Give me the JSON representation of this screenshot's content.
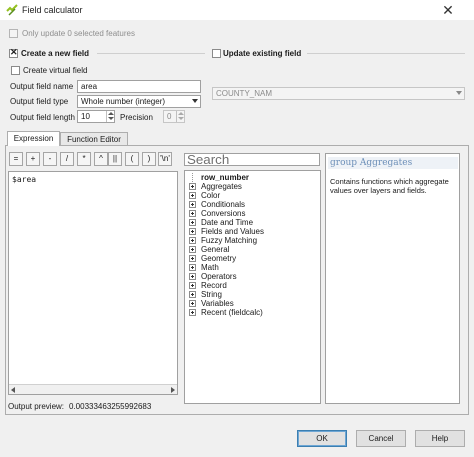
{
  "window": {
    "title": "Field calculator",
    "close_glyph": "✕"
  },
  "options": {
    "only_update_selected": "Only update 0 selected features",
    "create_new_field": "Create a new field",
    "update_existing_field": "Update existing field",
    "create_virtual_field": "Create virtual field"
  },
  "new_field": {
    "name_label": "Output field name",
    "name_value": "area",
    "type_label": "Output field type",
    "type_value": "Whole number (integer)",
    "length_label": "Output field length",
    "length_value": "10",
    "precision_label": "Precision",
    "precision_value": "0"
  },
  "existing_field": {
    "value": "COUNTY_NAM"
  },
  "tabs": [
    {
      "label": "Expression"
    },
    {
      "label": "Function Editor"
    }
  ],
  "operators": [
    "=",
    "+",
    "-",
    "/",
    "*",
    "^",
    "||",
    "(",
    ")",
    "'\\n'"
  ],
  "expression": {
    "text": "$area"
  },
  "search": {
    "placeholder": "Search"
  },
  "functions": [
    "row_number",
    "Aggregates",
    "Color",
    "Conditionals",
    "Conversions",
    "Date and Time",
    "Fields and Values",
    "Fuzzy Matching",
    "General",
    "Geometry",
    "Math",
    "Operators",
    "Record",
    "String",
    "Variables",
    "Recent (fieldcalc)"
  ],
  "help": {
    "title": "group Aggregates",
    "body": "Contains functions which aggregate values over layers and fields."
  },
  "preview": {
    "label": "Output preview:",
    "value": "0.00333463255992683"
  },
  "footer": {
    "ok": "OK",
    "cancel": "Cancel",
    "help": "Help"
  },
  "colors": {
    "help_title": "#6c8fb8",
    "qgis_icon": "#94c11f"
  }
}
